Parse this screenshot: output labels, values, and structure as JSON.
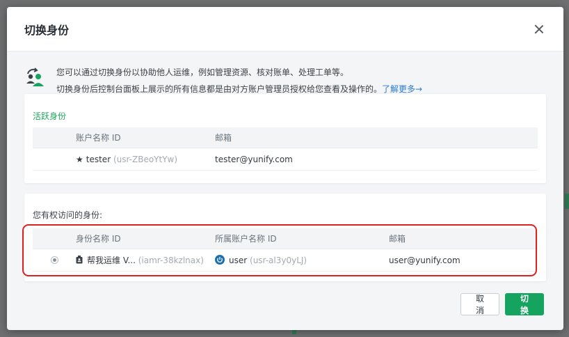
{
  "modal": {
    "title": "切换身份"
  },
  "intro": {
    "line1": "您可以通过切换身份以协助他人运维，例如管理资源、核对账单、处理工单等。",
    "line2": "切换身份后控制台面板上展示的所有信息都是由对方账户管理员授权给您查看及操作的。",
    "learn_more": "了解更多→"
  },
  "active_identity": {
    "title": "活跃身份",
    "columns": [
      "账户名称 ID",
      "邮箱"
    ],
    "row": {
      "name": "tester",
      "id": "(usr-ZBeoYtYw)",
      "email": "tester@yunify.com"
    }
  },
  "accessible_identities": {
    "title": "您有权访问的身份:",
    "columns": [
      "身份名称 ID",
      "所属账户名称 ID",
      "邮箱"
    ],
    "rows": [
      {
        "identity_name": "帮我运维 V...",
        "identity_id": "(iamr-38kzlnax)",
        "account_name": "user",
        "account_id": "(usr-al3y0yLJ)",
        "email": "user@yunify.com"
      }
    ]
  },
  "footer": {
    "cancel_label": "取消",
    "switch_label": "切换"
  },
  "colors": {
    "accent_green": "#15a460",
    "link_blue": "#2a7bd6",
    "highlight_red": "#d8231f"
  }
}
